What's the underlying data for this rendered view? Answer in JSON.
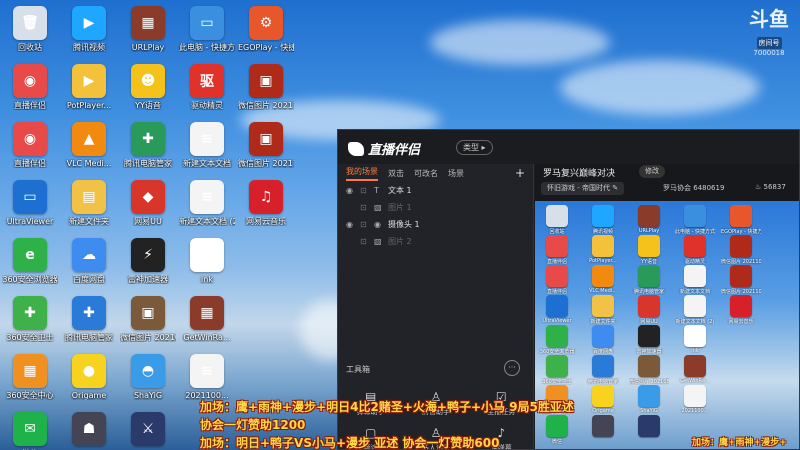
{
  "desktop": {
    "icons": [
      {
        "label": "回收站",
        "glyph": "🗑",
        "color": "#d7dfe8"
      },
      {
        "label": "腾讯视频",
        "glyph": "▶",
        "color": "#1fa7ff"
      },
      {
        "label": "URLPlay",
        "glyph": "▦",
        "color": "#8a3b2a"
      },
      {
        "label": "此电脑 - 快捷方式",
        "glyph": "▭",
        "color": "#3b8fdf"
      },
      {
        "label": "EGOPlay - 快捷方式",
        "glyph": "⚙",
        "color": "#e8562c"
      },
      {
        "label": "直播伴侣",
        "glyph": "◉",
        "color": "#e84a4a"
      },
      {
        "label": "PotPlayer...",
        "glyph": "▶",
        "color": "#f3c13a"
      },
      {
        "label": "YY语音",
        "glyph": "☻",
        "color": "#f4c21a"
      },
      {
        "label": "驱动精灵",
        "glyph": "驱",
        "color": "#e0322a"
      },
      {
        "label": "微信图片 2021100...",
        "glyph": "▣",
        "color": "#b02a1a"
      },
      {
        "label": "直播伴侣",
        "glyph": "◉",
        "color": "#e84a4a"
      },
      {
        "label": "VLC Medi...",
        "glyph": "▲",
        "color": "#f28a10"
      },
      {
        "label": "腾讯电脑管家",
        "glyph": "✚",
        "color": "#2a9a5a"
      },
      {
        "label": "新建文本文档",
        "glyph": "≡",
        "color": "#f4f4f4"
      },
      {
        "label": "微信图片 2021100...",
        "glyph": "▣",
        "color": "#b02a1a"
      },
      {
        "label": "UltraViewer",
        "glyph": "▭",
        "color": "#1d6fd1"
      },
      {
        "label": "新建文件夹",
        "glyph": "▤",
        "color": "#f2c247"
      },
      {
        "label": "网易UU",
        "glyph": "◆",
        "color": "#d8362b"
      },
      {
        "label": "新建文本文档 (2)",
        "glyph": "≡",
        "color": "#f4f4f4"
      },
      {
        "label": "网易云音乐",
        "glyph": "♫",
        "color": "#d8202a"
      },
      {
        "label": "360安全浏览器",
        "glyph": "e",
        "color": "#2fb14a"
      },
      {
        "label": "百度网盘",
        "glyph": "☁",
        "color": "#3f8cf0"
      },
      {
        "label": "雷神加速器",
        "glyph": "⚡",
        "color": "#222"
      },
      {
        "label": "ink",
        "glyph": "k",
        "color": "#ffffff"
      },
      {
        "label": "",
        "glyph": "",
        "color": "transparent"
      },
      {
        "label": "360安全卫士",
        "glyph": "✚",
        "color": "#3fb14a"
      },
      {
        "label": "腾讯电脑管家",
        "glyph": "✚",
        "color": "#2a7ad8"
      },
      {
        "label": "微信图片 2021080...",
        "glyph": "▣",
        "color": "#7a5a3a"
      },
      {
        "label": "GetWinRa...",
        "glyph": "▦",
        "color": "#8a3b2a"
      },
      {
        "label": "",
        "glyph": "",
        "color": "transparent"
      },
      {
        "label": "360安全中心",
        "glyph": "▦",
        "color": "#f09020"
      },
      {
        "label": "Origame",
        "glyph": "●",
        "color": "#f7d21e"
      },
      {
        "label": "ShaYiG",
        "glyph": "◓",
        "color": "#3a9be8"
      },
      {
        "label": "2021100...",
        "glyph": "≡",
        "color": "#f4f4f4"
      },
      {
        "label": "",
        "glyph": "",
        "color": "transparent"
      },
      {
        "label": "微信",
        "glyph": "✉",
        "color": "#1fb14a"
      },
      {
        "label": "",
        "glyph": "☗",
        "color": "#445"
      },
      {
        "label": "",
        "glyph": "⚔",
        "color": "#2a3a6a"
      }
    ]
  },
  "watermark": {
    "logo": "斗鱼",
    "tag": "房间号",
    "room": "7000018"
  },
  "app": {
    "logo": "直播伴侣",
    "type_button": "类型 ▸",
    "tabs": [
      "我的场景",
      "双击",
      "可改名",
      "场景"
    ],
    "add": "+",
    "sources": [
      {
        "name": "文本 1",
        "kind": "T",
        "visible": true
      },
      {
        "name": "图片 1",
        "kind": "▧",
        "visible": false
      },
      {
        "name": "摄像头 1",
        "kind": "◉",
        "visible": true
      },
      {
        "name": "图片 2",
        "kind": "▧",
        "visible": false
      }
    ],
    "toolbox_title": "工具箱",
    "toolbox_more": "···",
    "tools": [
      {
        "label": "弹幕助手",
        "icon": "▤"
      },
      {
        "label": "房管助手",
        "icon": "♙"
      },
      {
        "label": "主播任务",
        "icon": "☑"
      }
    ],
    "tools_row2": [
      {
        "label": "视频连麦",
        "icon": "▢"
      },
      {
        "label": "多人连麦",
        "icon": "♙"
      },
      {
        "label": "读弹幕",
        "icon": "♪"
      }
    ],
    "room_title": "罗马复兴巅峰对决",
    "edit_button": "修改",
    "category": "怀旧游戏 - 帝国时代 ✎",
    "stats": [
      {
        "label": "罗马协会",
        "value": "6480619"
      },
      {
        "label": "♨",
        "value": "56837"
      }
    ]
  },
  "captions": [
    {
      "text": "加场：鹰+雨神+漫步+明日4比2赌圣+火海+鸭子+小马  9局5胜亚述"
    },
    {
      "text": "协会一灯赞助1200"
    },
    {
      "text": "加场：明日+鸭子VS小马+漫步 亚述 协会一灯赞助600"
    },
    {
      "text": "加场：鹰+雨神+漫步+"
    }
  ]
}
